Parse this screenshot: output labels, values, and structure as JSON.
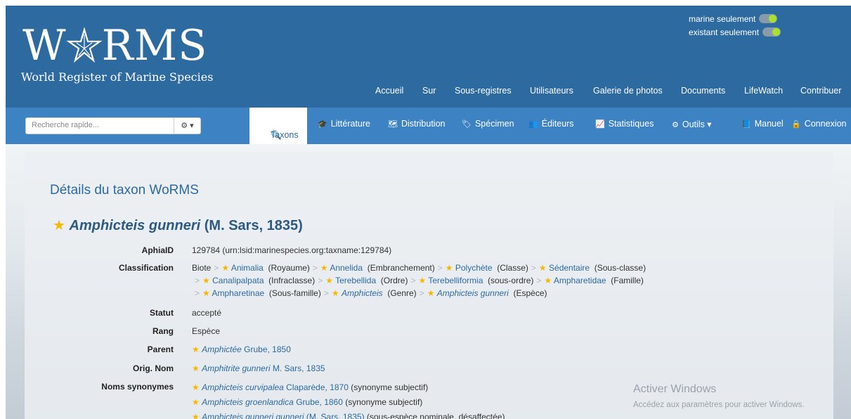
{
  "header": {
    "logo_text": "W",
    "logo_text_rest": "RMS",
    "logo_subtitle": "World Register of Marine Species",
    "toggle_marine": "marine seulement",
    "toggle_extant": "existant seulement",
    "toggle_color": "#a6e22e",
    "top_nav": [
      "Accueil",
      "Sur",
      "Sous-registres",
      "Utilisateurs",
      "Galerie de photos",
      "Documents",
      "LifeWatch",
      "Contribuer"
    ]
  },
  "navbar": {
    "search_placeholder": "Recherche rapide...",
    "gear_icon": "⚙ ▾",
    "items": [
      {
        "icon": "🔍",
        "label": "Taxons"
      },
      {
        "icon": "🎓",
        "label": "Littérature"
      },
      {
        "icon": "🗺",
        "label": "Distribution"
      },
      {
        "icon": "🏷",
        "label": "Spécimen"
      },
      {
        "icon": "👥",
        "label": "Éditeurs"
      },
      {
        "icon": "📈",
        "label": "Statistiques"
      },
      {
        "icon": "⚙",
        "label": "Outils ▾"
      },
      {
        "icon": "📘",
        "label": "Manuel"
      },
      {
        "icon": "🔒",
        "label": "Connexion"
      }
    ]
  },
  "page": {
    "title": "Détails du taxon WoRMS",
    "taxon_name": "Amphicteis gunneri",
    "taxon_author": "(M. Sars, 1835)"
  },
  "fields": {
    "aphia_label": "AphiaID",
    "aphia_value": "129784  (urn:lsid:marinespecies.org:taxname:129784)",
    "classification_label": "Classification",
    "class_line1": [
      {
        "text": "Biote",
        "link": false,
        "rank": ""
      },
      {
        "text": "Animalia",
        "link": true,
        "rank": "(Royaume)"
      },
      {
        "text": "Annelida",
        "link": true,
        "rank": "(Embranchement)"
      },
      {
        "text": "Polychète",
        "link": true,
        "rank": "(Classe)"
      },
      {
        "text": "Sédentaire",
        "link": true,
        "rank": "(Sous-classe)"
      }
    ],
    "class_line2": [
      {
        "text": "Canalipalpata",
        "link": true,
        "rank": "(Infraclasse)"
      },
      {
        "text": "Terebellida",
        "link": true,
        "rank": "(Ordre)"
      },
      {
        "text": "Terebelliformia",
        "link": true,
        "rank": "(sous-ordre)"
      },
      {
        "text": "Ampharetidae",
        "link": true,
        "rank": "(Famille)"
      }
    ],
    "class_line3": [
      {
        "text": "Ampharetinae",
        "link": true,
        "rank": "(Sous-famille)"
      },
      {
        "text": "Amphicteis",
        "link": true,
        "rank": "(Genre)",
        "italic": true
      },
      {
        "text": "Amphicteis gunneri",
        "link": true,
        "rank": "(Espèce)",
        "italic": true
      }
    ],
    "status_label": "Statut",
    "status_value": "accepté",
    "rank_label": "Rang",
    "rank_value": "Espèce",
    "parent_label": "Parent",
    "parent_name": "Amphictée",
    "parent_author": " Grube, 1850",
    "orig_label": "Orig. Nom",
    "orig_name": "Amphitrite gunneri",
    "orig_author": " M. Sars, 1835",
    "syn_label": "Noms synonymes",
    "synonyms": [
      {
        "name": "Amphicteis curvipalea",
        "author": " Claparède, 1870",
        "note": " (synonyme subjectif)"
      },
      {
        "name": "Amphicteis groenlandica",
        "author": " Grube, 1860",
        "note": " (synonyme subjectif)"
      },
      {
        "name": "Amphicteis gunneri gunneri",
        "author": " (M. Sars, 1835)",
        "note": " (sous-espèce nominale, désaffectée)"
      }
    ]
  },
  "watermark": {
    "line1": "Activer Windows",
    "line2": "Accédez aux paramètres pour activer Windows."
  }
}
